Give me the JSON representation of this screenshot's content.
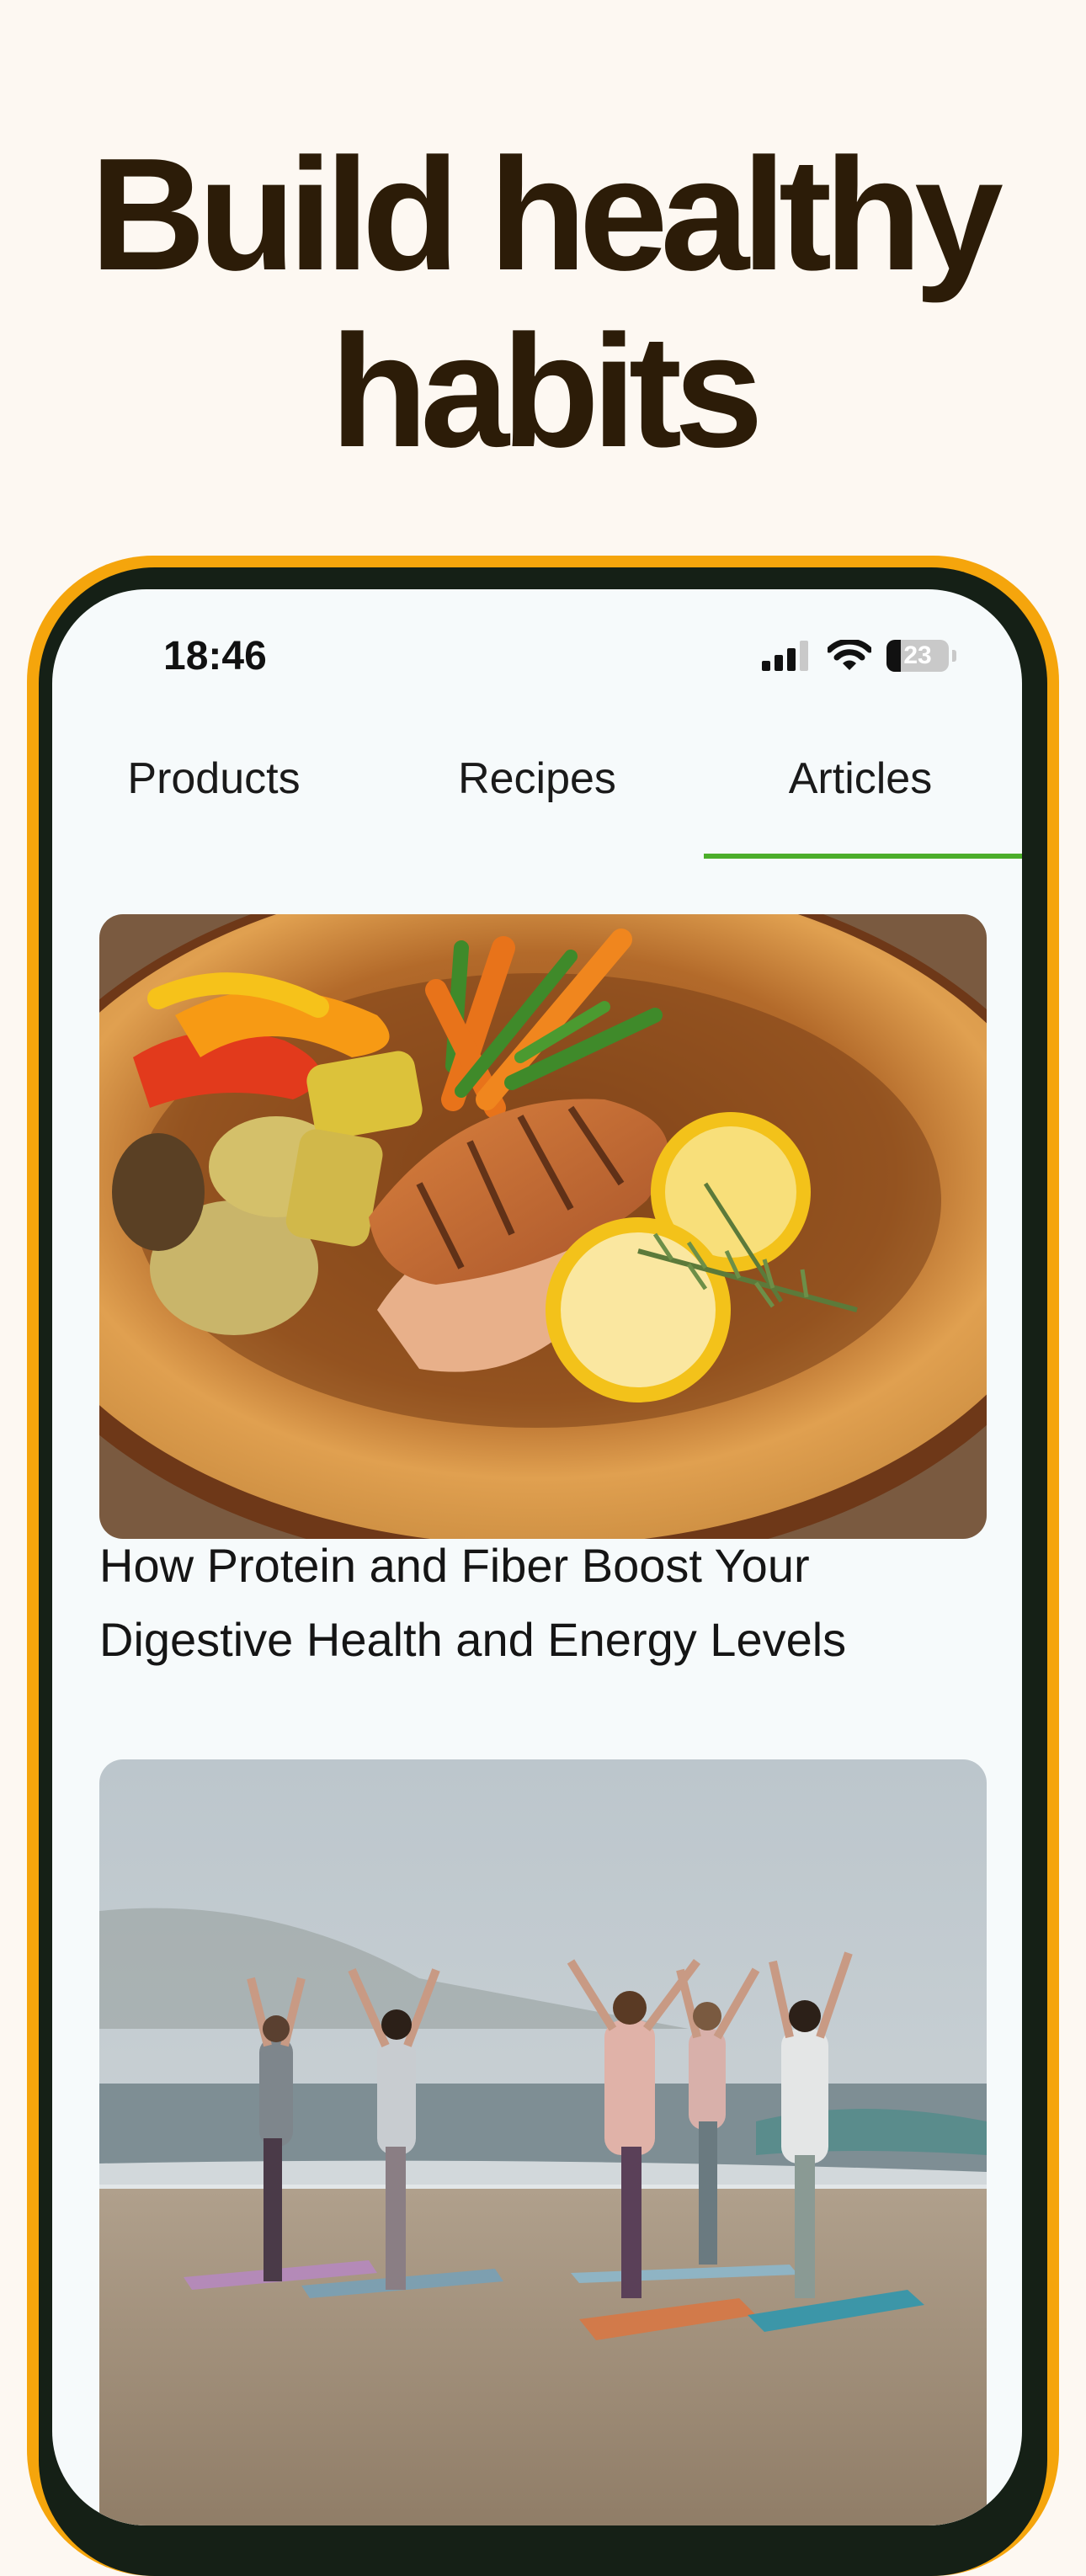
{
  "headline": {
    "line1": "Build healthy",
    "line2": "habits"
  },
  "status_bar": {
    "time": "18:46",
    "battery_level": "23",
    "battery_fraction": 0.23,
    "icons": [
      "cellular-signal-icon",
      "wifi-icon",
      "battery-icon"
    ]
  },
  "tabs": [
    {
      "label": "Products",
      "active": false
    },
    {
      "label": "Recipes",
      "active": false
    },
    {
      "label": "Articles",
      "active": true
    }
  ],
  "articles": [
    {
      "image": "grilled-salmon-vegetables-photo",
      "title": "How Protein and Fiber Boost Your Digestive Health and Energy Levels"
    },
    {
      "image": "beach-yoga-group-photo",
      "title": ""
    }
  ],
  "colors": {
    "background": "#fdf8f2",
    "headline": "#2c1c08",
    "phone_frame": "#f5a50c",
    "phone_bezel": "#152016",
    "screen": "#f6fafb",
    "tab_indicator": "#4cae2a"
  }
}
